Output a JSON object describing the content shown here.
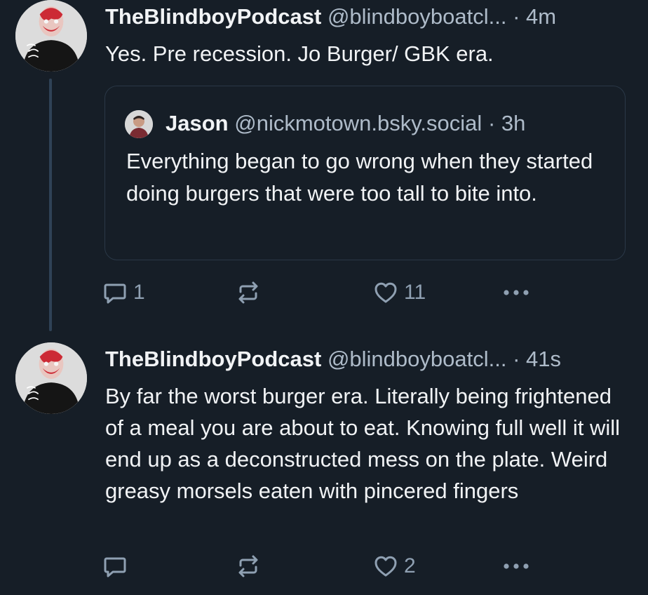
{
  "colors": {
    "background": "#161e27",
    "text_primary": "#f1f3f5",
    "text_secondary": "#aebbc9",
    "icon": "#8fa0b2",
    "thread_line": "#2f4256",
    "quote_border": "#2a3847"
  },
  "posts": [
    {
      "author": {
        "display_name": "TheBlindboyPodcast",
        "handle": "@blindboyboatcl...",
        "avatar_icon": "avatar-image"
      },
      "separator": "·",
      "time": "4m",
      "text": "Yes. Pre recession. Jo Burger/ GBK era.",
      "quote": {
        "author": {
          "display_name": "Jason",
          "handle": "@nickmotown.bsky.social",
          "avatar_icon": "avatar-image"
        },
        "separator": "·",
        "time": "3h",
        "text": "Everything began to go wrong when they started doing burgers that were too tall to bite into."
      },
      "actions": {
        "reply_count": "1",
        "repost_count": "",
        "like_count": "11"
      },
      "icons": [
        "reply-icon",
        "repost-icon",
        "like-icon",
        "more-icon"
      ]
    },
    {
      "author": {
        "display_name": "TheBlindboyPodcast",
        "handle": "@blindboyboatcl...",
        "avatar_icon": "avatar-image"
      },
      "separator": "·",
      "time": "41s",
      "text": "By far the worst burger era. Literally being frightened of a meal you are about to eat. Knowing full well it will end up as a deconstructed mess on the plate. Weird greasy morsels eaten with pincered fingers",
      "actions": {
        "reply_count": "",
        "repost_count": "",
        "like_count": "2"
      },
      "icons": [
        "reply-icon",
        "repost-icon",
        "like-icon",
        "more-icon"
      ]
    }
  ]
}
